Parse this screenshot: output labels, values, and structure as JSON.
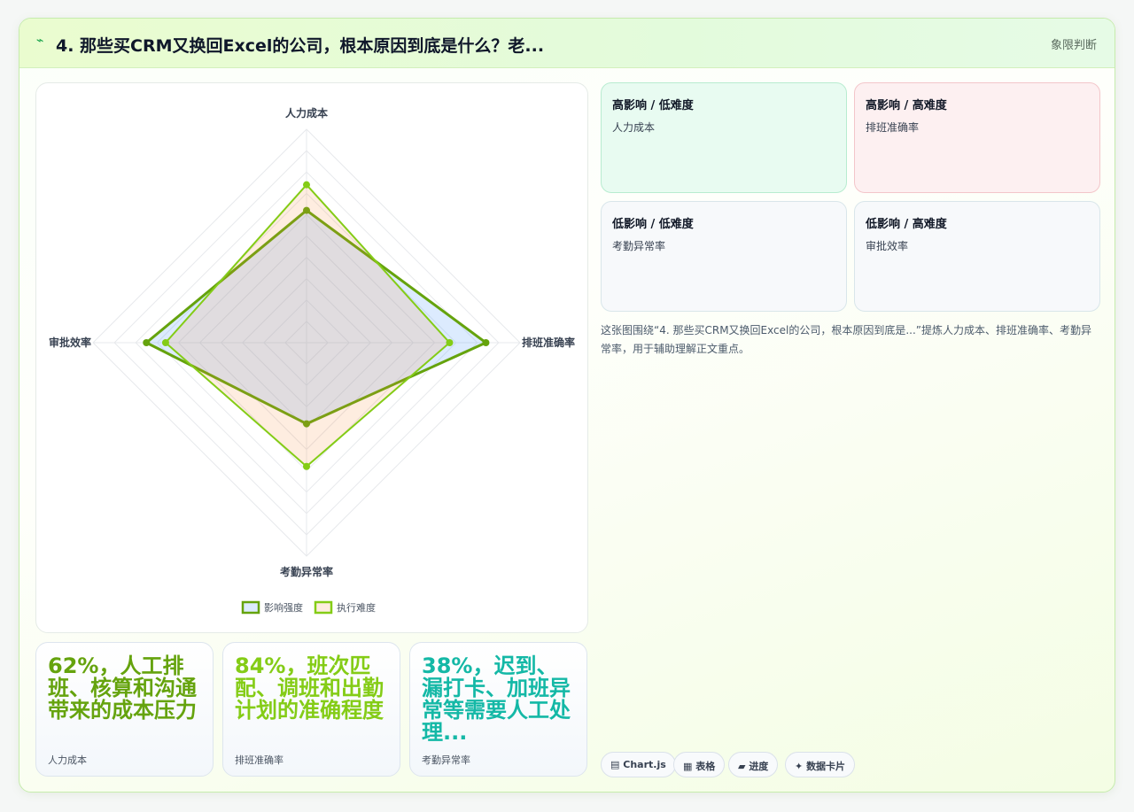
{
  "header": {
    "icon": "sparkline-icon",
    "title": "4. 那些买CRM又换回Excel的公司，根本原因到底是什么？老...",
    "tag": "象限判断"
  },
  "chart_data": {
    "type": "radar",
    "categories": [
      "人力成本",
      "排班准确率",
      "考勤异常率",
      "审批效率"
    ],
    "series": [
      {
        "name": "影响强度",
        "values": [
          62,
          84,
          38,
          75
        ],
        "color": "#65a30d"
      },
      {
        "name": "执行难度",
        "values": [
          74,
          67,
          58,
          66
        ],
        "color": "#84cc16"
      }
    ],
    "rlim": [
      0,
      100
    ],
    "grid": true,
    "legend": "bottom"
  },
  "stats": [
    {
      "big": "62%，人工排班、核算和沟通带来的成本压力",
      "label": "人力成本",
      "color": "#65a30d"
    },
    {
      "big": "84%，班次匹配、调班和出勤计划的准确程度",
      "label": "排班准确率",
      "color": "#84cc16"
    },
    {
      "big": "38%，迟到、漏打卡、加班异常等需要人工处理...",
      "label": "考勤异常率",
      "color": "#14b8a6"
    }
  ],
  "quadrants": [
    {
      "title": "高影响 / 低难度",
      "item": "人力成本"
    },
    {
      "title": "高影响 / 高难度",
      "item": "排班准确率"
    },
    {
      "title": "低影响 / 低难度",
      "item": "考勤异常率"
    },
    {
      "title": "低影响 / 高难度",
      "item": "审批效率"
    }
  ],
  "caption": "这张图围绕“4. 那些买CRM又换回Excel的公司，根本原因到底是...”提炼人力成本、排班准确率、考勤异常率，用于辅助理解正文重点。",
  "chips": [
    {
      "icon": "chart-icon",
      "label": "Chart.js"
    },
    {
      "icon": "table-icon",
      "label": "表格"
    },
    {
      "icon": "folder-icon",
      "label": "进度"
    },
    {
      "icon": "sparkle-icon",
      "label": "数据卡片"
    }
  ]
}
